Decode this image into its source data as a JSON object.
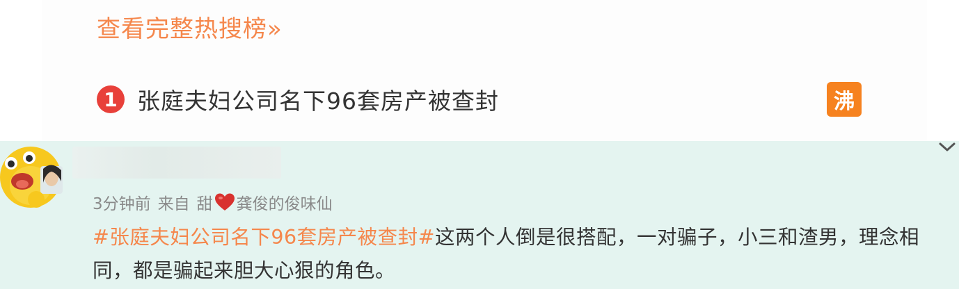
{
  "hot_search": {
    "full_list_link": "查看完整热搜榜»",
    "item": {
      "rank": "1",
      "title": "张庭夫妇公司名下96套房产被查封",
      "tag": "沸"
    }
  },
  "comment": {
    "time": "3分钟前",
    "from_label": "来自",
    "source_prefix": "甜",
    "source_suffix": "龚俊的俊味仙",
    "hashtag": "#张庭夫妇公司名下96套房产被查封#",
    "body": "这两个人倒是很搭配，一对骗子，小三和渣男，理念相同，都是骗起来胆大心狠的角色。"
  },
  "colors": {
    "accent_orange": "#f5874c",
    "rank_red": "#e8403a",
    "tag_orange": "#f6821f",
    "comment_bg": "#e4f4f0",
    "heart_red": "#d8322f"
  },
  "icons": {
    "rank_badge": "rank-1-badge",
    "heart": "heart-icon",
    "chevron": "chevron-down-icon",
    "avatar": "avatar-emoji"
  }
}
